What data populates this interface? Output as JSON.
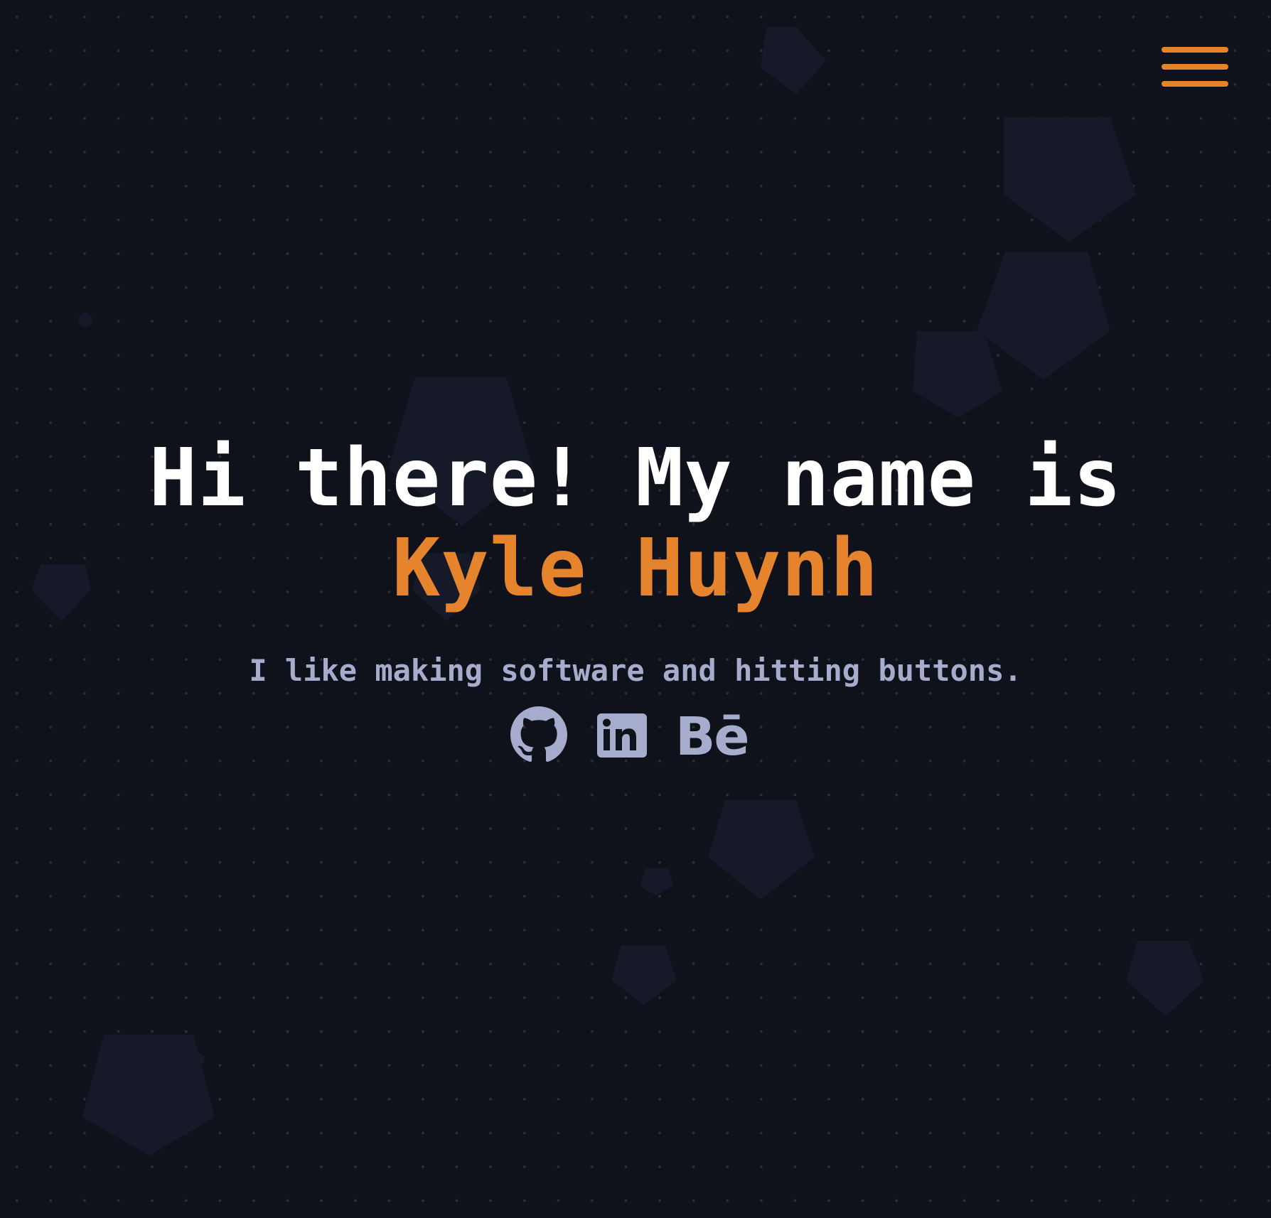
{
  "menu": {
    "icon": "hamburger-menu-icon"
  },
  "hero": {
    "greeting": "Hi there! My name is ",
    "name": "Kyle Huynh",
    "tagline": "I like making software and hitting buttons."
  },
  "socials": [
    {
      "name": "GitHub",
      "icon": "github-icon"
    },
    {
      "name": "LinkedIn",
      "icon": "linkedin-icon"
    },
    {
      "name": "Behance",
      "icon": "behance-icon",
      "glyph": "Bē"
    }
  ],
  "colors": {
    "background": "#0f121b",
    "accent": "#e6832d",
    "heading": "#ffffff",
    "muted": "#a6accb",
    "dot": "#2c3140",
    "shape": "#171a27"
  }
}
